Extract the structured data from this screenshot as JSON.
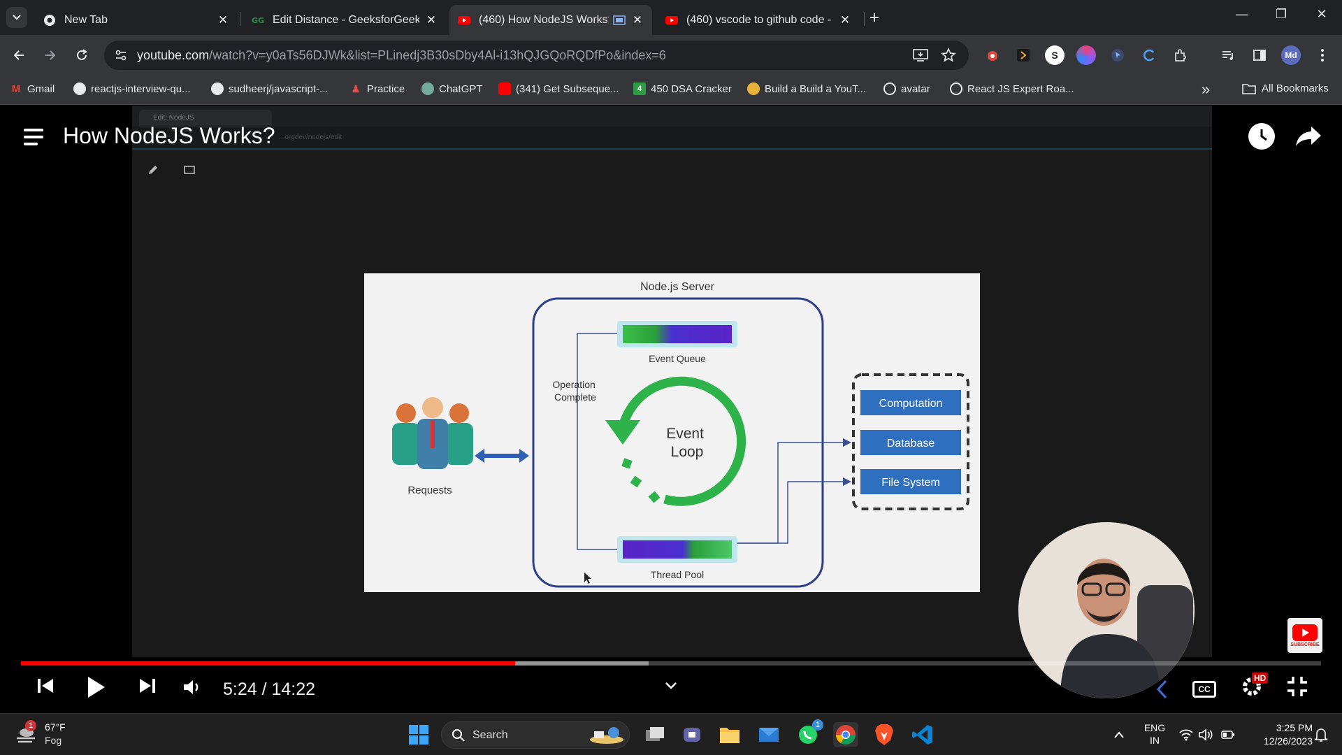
{
  "browser": {
    "tabs": [
      {
        "title": "New Tab",
        "icon": "chrome-icon"
      },
      {
        "title": "Edit Distance - GeeksforGeeks",
        "icon": "geeksforgeeks-icon"
      },
      {
        "title": "(460) How NodeJS Works? -",
        "icon": "youtube-icon",
        "active": true
      },
      {
        "title": "(460) vscode to github code - Y",
        "icon": "youtube-icon"
      }
    ],
    "url_domain": "youtube.com",
    "url_path": "/watch?v=y0aTs56DJWk&list=PLinedj3B30sDby4Al-i13hQJGQoRQDfPo&index=6",
    "extension_s_label": "S",
    "profile_label": "Md",
    "bookmarks": [
      {
        "label": "Gmail",
        "icon": "gmail-icon"
      },
      {
        "label": "reactjs-interview-qu...",
        "icon": "github-icon"
      },
      {
        "label": "sudheerj/javascript-...",
        "icon": "github-icon"
      },
      {
        "label": "Practice",
        "icon": "practice-icon"
      },
      {
        "label": "ChatGPT",
        "icon": "chatgpt-icon"
      },
      {
        "label": "(341) Get Subseque...",
        "icon": "youtube-icon"
      },
      {
        "label": "450 DSA Cracker",
        "icon": "dsa-icon"
      },
      {
        "label": "Build a Build a YouT...",
        "icon": "build-icon"
      },
      {
        "label": "avatar",
        "icon": "globe-icon"
      },
      {
        "label": "React JS Expert Roa...",
        "icon": "globe-icon"
      }
    ],
    "all_bookmarks_label": "All Bookmarks",
    "overflow_label": "»"
  },
  "video": {
    "title": "How NodeJS Works?",
    "inner_tab_label": "Edit: NodeJS",
    "inner_url": "...orgdev/nodejs/edit",
    "current_time": "5:24",
    "duration": "14:22",
    "time_display": "5:24 / 14:22",
    "played_fraction": 0.38,
    "buffered_fraction": 0.483,
    "hd_badge": "HD",
    "cc_label": "CC",
    "subscribe_label": "SUBSCRIBE"
  },
  "diagram": {
    "server_title": "Node.js Server",
    "event_queue": "Event Queue",
    "operation_complete": [
      "Operation",
      "Complete"
    ],
    "event_loop": [
      "Event",
      "Loop"
    ],
    "thread_pool": "Thread Pool",
    "requests": "Requests",
    "resources": [
      "Computation",
      "Database",
      "File System"
    ]
  },
  "taskbar": {
    "weather_temp": "67°F",
    "weather_desc": "Fog",
    "weather_badge": "1",
    "search_label": "Search",
    "whatsapp_badge": "1",
    "language": "ENG",
    "region": "IN",
    "time": "3:25 PM",
    "date": "12/26/2023"
  },
  "colors": {
    "youtube_red": "#ff0000",
    "resource_blue": "#2f6fbf",
    "loop_green": "#2db34a",
    "queue_purple": "#5a23c8"
  }
}
